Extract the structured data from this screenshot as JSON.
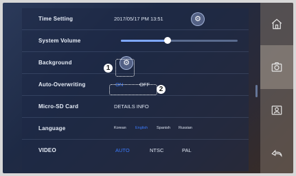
{
  "settings": {
    "time": {
      "label": "Time Setting",
      "value": "2017/05/17   PM 13:51"
    },
    "volume": {
      "label": "System Volume",
      "level": 0.4
    },
    "background": {
      "label": "Background"
    },
    "overwrite": {
      "label": "Auto-Overwriting",
      "on": "ON",
      "off": "OFF",
      "selected": "ON"
    },
    "sdcard": {
      "label": "Micro-SD Card",
      "value": "DETAILS INFO"
    },
    "language": {
      "label": "Language",
      "options": [
        "Korean",
        "English",
        "Spanish",
        "Russian"
      ],
      "selected": "English"
    },
    "video": {
      "label": "VIDEO",
      "options": [
        "AUTO",
        "NTSC",
        "PAL"
      ],
      "selected": "AUTO"
    }
  },
  "callouts": {
    "one": "1",
    "two": "2"
  },
  "colors": {
    "accent": "#3b7bff"
  },
  "icons": {
    "home": "home-icon",
    "settings": "camera-settings-icon",
    "contacts": "contacts-icon",
    "back": "back-icon"
  }
}
